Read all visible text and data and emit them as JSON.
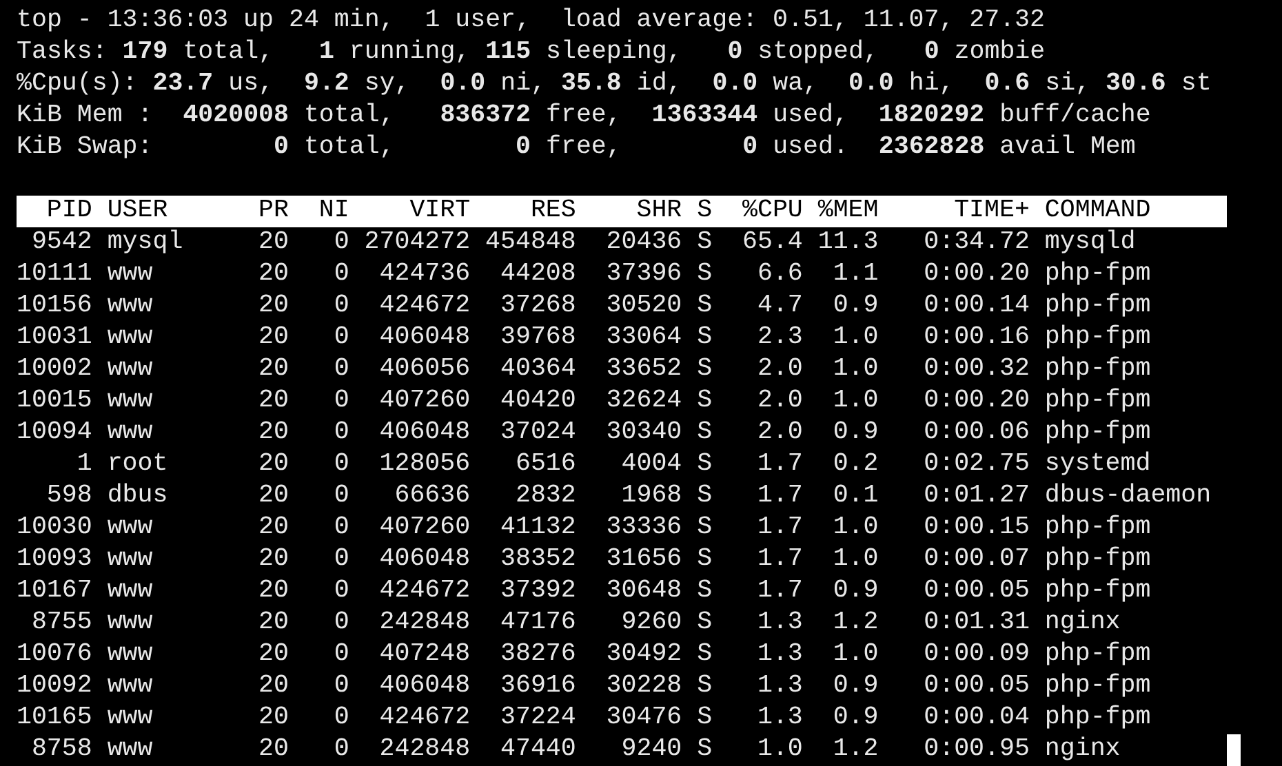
{
  "summary_lines": [
    "top - 13:36:03 up 24 min,  1 user,  load average: 0.51, 11.07, 27.32",
    "Tasks: **179** total,   **1** running, **115** sleeping,   **0** stopped,   **0** zombie",
    "%Cpu(s): **23.7** us,  **9.2** sy,  **0.0** ni, **35.8** id,  **0.0** wa,  **0.0** hi,  **0.6** si, **30.6** st",
    "KiB Mem :  **4020008** total,   **836372** free,  **1363344** used,  **1820292** buff/cache",
    "KiB Swap:        **0** total,        **0** free,        **0** used.  **2362828** avail Mem"
  ],
  "table": {
    "columns": [
      "PID",
      "USER",
      "PR",
      "NI",
      "VIRT",
      "RES",
      "SHR",
      "S",
      "%CPU",
      "%MEM",
      "TIME+",
      "COMMAND"
    ],
    "rows": [
      [
        "9542",
        "mysql",
        "20",
        "0",
        "2704272",
        "454848",
        "20436",
        "S",
        "65.4",
        "11.3",
        "0:34.72",
        "mysqld"
      ],
      [
        "10111",
        "www",
        "20",
        "0",
        "424736",
        "44208",
        "37396",
        "S",
        "6.6",
        "1.1",
        "0:00.20",
        "php-fpm"
      ],
      [
        "10156",
        "www",
        "20",
        "0",
        "424672",
        "37268",
        "30520",
        "S",
        "4.7",
        "0.9",
        "0:00.14",
        "php-fpm"
      ],
      [
        "10031",
        "www",
        "20",
        "0",
        "406048",
        "39768",
        "33064",
        "S",
        "2.3",
        "1.0",
        "0:00.16",
        "php-fpm"
      ],
      [
        "10002",
        "www",
        "20",
        "0",
        "406056",
        "40364",
        "33652",
        "S",
        "2.0",
        "1.0",
        "0:00.32",
        "php-fpm"
      ],
      [
        "10015",
        "www",
        "20",
        "0",
        "407260",
        "40420",
        "32624",
        "S",
        "2.0",
        "1.0",
        "0:00.20",
        "php-fpm"
      ],
      [
        "10094",
        "www",
        "20",
        "0",
        "406048",
        "37024",
        "30340",
        "S",
        "2.0",
        "0.9",
        "0:00.06",
        "php-fpm"
      ],
      [
        "1",
        "root",
        "20",
        "0",
        "128056",
        "6516",
        "4004",
        "S",
        "1.7",
        "0.2",
        "0:02.75",
        "systemd"
      ],
      [
        "598",
        "dbus",
        "20",
        "0",
        "66636",
        "2832",
        "1968",
        "S",
        "1.7",
        "0.1",
        "0:01.27",
        "dbus-daemon"
      ],
      [
        "10030",
        "www",
        "20",
        "0",
        "407260",
        "41132",
        "33336",
        "S",
        "1.7",
        "1.0",
        "0:00.15",
        "php-fpm"
      ],
      [
        "10093",
        "www",
        "20",
        "0",
        "406048",
        "38352",
        "31656",
        "S",
        "1.7",
        "1.0",
        "0:00.07",
        "php-fpm"
      ],
      [
        "10167",
        "www",
        "20",
        "0",
        "424672",
        "37392",
        "30648",
        "S",
        "1.7",
        "0.9",
        "0:00.05",
        "php-fpm"
      ],
      [
        "8755",
        "www",
        "20",
        "0",
        "242848",
        "47176",
        "9260",
        "S",
        "1.3",
        "1.2",
        "0:01.31",
        "nginx"
      ],
      [
        "10076",
        "www",
        "20",
        "0",
        "407248",
        "38276",
        "30492",
        "S",
        "1.3",
        "1.0",
        "0:00.09",
        "php-fpm"
      ],
      [
        "10092",
        "www",
        "20",
        "0",
        "406048",
        "36916",
        "30228",
        "S",
        "1.3",
        "0.9",
        "0:00.05",
        "php-fpm"
      ],
      [
        "10165",
        "www",
        "20",
        "0",
        "424672",
        "37224",
        "30476",
        "S",
        "1.3",
        "0.9",
        "0:00.04",
        "php-fpm"
      ],
      [
        "8758",
        "www",
        "20",
        "0",
        "242848",
        "47440",
        "9240",
        "S",
        "1.0",
        "1.2",
        "0:00.95",
        "nginx"
      ]
    ]
  },
  "cursor": {
    "visible": true
  }
}
